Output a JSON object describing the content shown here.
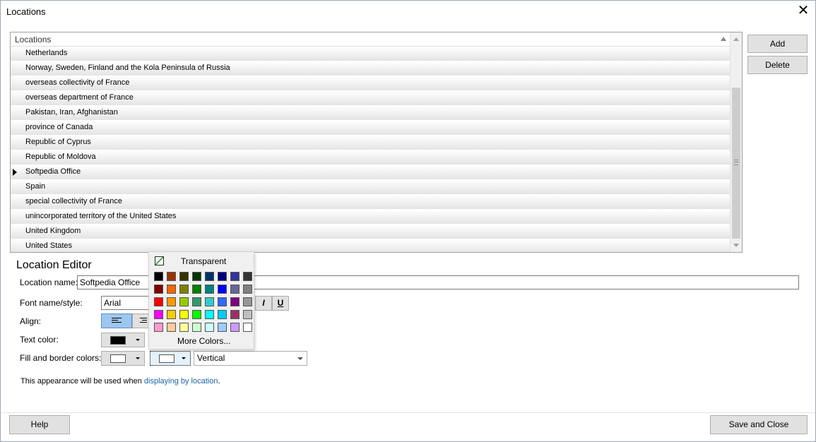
{
  "window": {
    "title": "Locations",
    "close_glyph": "✕"
  },
  "grid": {
    "header": "Locations",
    "rows": [
      "Netherlands",
      "Norway, Sweden, Finland and the Kola Peninsula of Russia",
      "overseas collectivity of France",
      "overseas department of France",
      "Pakistan, Iran, Afghanistan",
      "province of Canada",
      "Republic of Cyprus",
      "Republic of Moldova",
      "Softpedia Office",
      "Spain",
      "special collectivity of France",
      "unincorporated territory of the United States",
      "United Kingdom",
      "United States"
    ],
    "current_row": "Softpedia Office"
  },
  "buttons": {
    "add": "Add",
    "delete": "Delete",
    "help": "Help",
    "save_close": "Save and Close"
  },
  "editor": {
    "title": "Location Editor",
    "location_name_label": "Location name:",
    "location_name_value": "Softpedia Office",
    "font_label": "Font name/style:",
    "font_value": "Arial",
    "italic": "I",
    "underline": "U",
    "align_label": "Align:",
    "text_color_label": "Text color:",
    "fill_label": "Fill and border colors:",
    "gradient_value": "Vertical",
    "note_prefix": "This appearance will be used when ",
    "note_link": "displaying by location",
    "note_suffix": "."
  },
  "colors": {
    "text_color": "#000000",
    "fill_color": "#ffffff",
    "border_color": "#ffffff",
    "accent": "#1763a7"
  },
  "color_popup": {
    "transparent_label": "Transparent",
    "more_colors_label": "More Colors...",
    "palette": [
      [
        "#000000",
        "#993300",
        "#333300",
        "#003300",
        "#003366",
        "#000080",
        "#333399",
        "#333333"
      ],
      [
        "#800000",
        "#ff6600",
        "#808000",
        "#008000",
        "#008080",
        "#0000ff",
        "#666699",
        "#808080"
      ],
      [
        "#ff0000",
        "#ff9900",
        "#99cc00",
        "#339966",
        "#33cccc",
        "#3366ff",
        "#800080",
        "#969696"
      ],
      [
        "#ff00ff",
        "#ffcc00",
        "#ffff00",
        "#00ff00",
        "#00ffff",
        "#00ccff",
        "#993366",
        "#c0c0c0"
      ],
      [
        "#ff99cc",
        "#ffcc99",
        "#ffff99",
        "#ccffcc",
        "#ccffff",
        "#99ccff",
        "#cc99ff",
        "#ffffff"
      ]
    ]
  }
}
